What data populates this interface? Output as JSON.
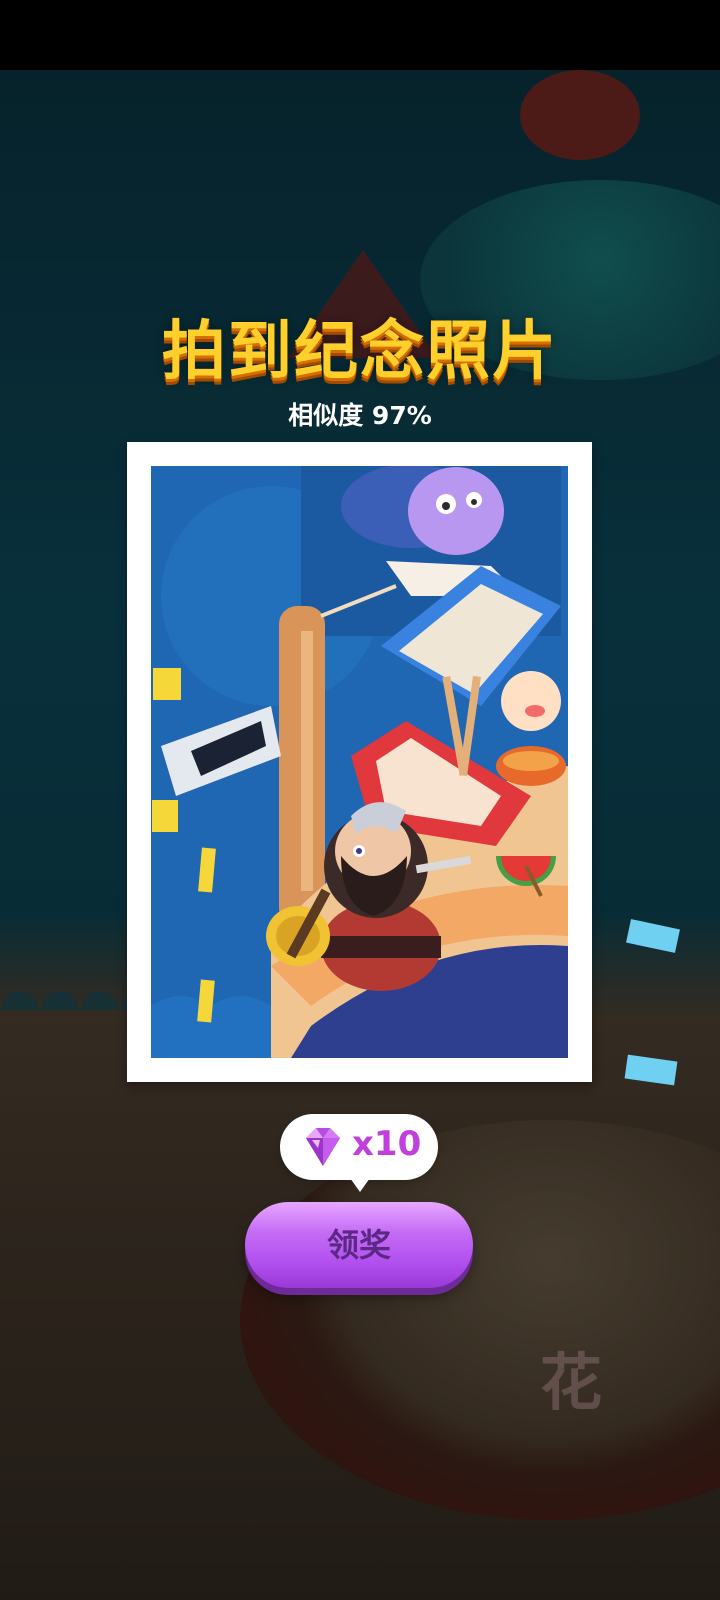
{
  "popup": {
    "title": "拍到纪念照片",
    "similarity": "相似度 97%"
  },
  "reward": {
    "icon": "gem-icon",
    "count": "x10"
  },
  "actions": {
    "claim_label": "领奖"
  },
  "background": {
    "sign_text": "花"
  },
  "colors": {
    "title": "#ffd02b",
    "button": "#b150ef",
    "reward_text": "#c33fdd",
    "overlay": "rgba(0,0,0,0.42)"
  }
}
